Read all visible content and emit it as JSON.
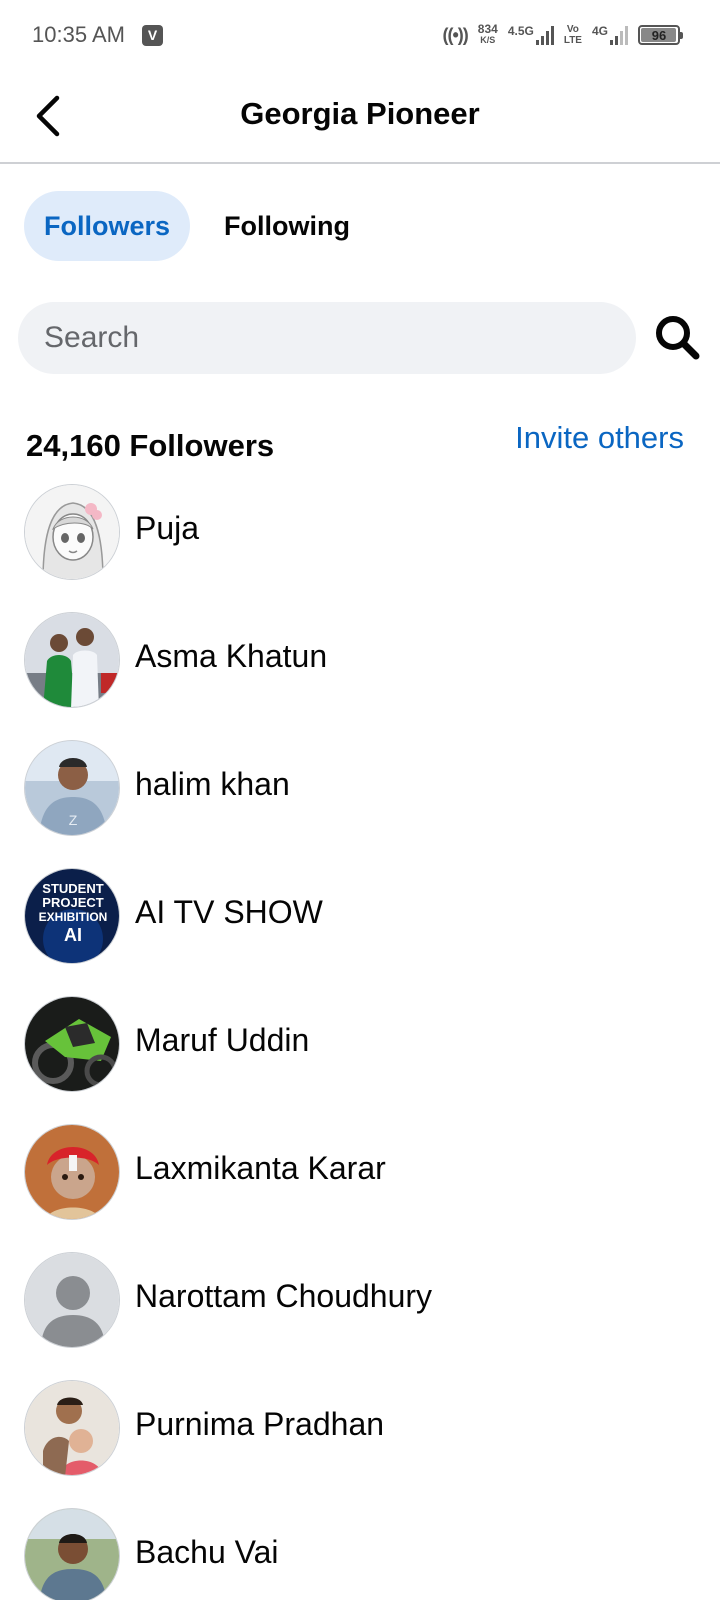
{
  "status_bar": {
    "time": "10:35 AM",
    "app_icon_letter": "V",
    "hotspot": "((•))",
    "speed_value": "834",
    "speed_unit": "K/S",
    "net1_label": "4.5G",
    "volte_top": "Vo",
    "volte_bottom": "LTE",
    "net2_label": "4G",
    "battery_percent": "96",
    "battery_level": 0.96
  },
  "header": {
    "title": "Georgia Pioneer"
  },
  "tabs": [
    {
      "label": "Followers",
      "active": true
    },
    {
      "label": "Following",
      "active": false
    }
  ],
  "search": {
    "placeholder": "Search",
    "value": ""
  },
  "summary": {
    "count_text": "24,160 Followers",
    "invite_label": "Invite others"
  },
  "followers": [
    {
      "name": "Puja",
      "avatar": "anime-girl"
    },
    {
      "name": "Asma Khatun",
      "avatar": "couple-photo"
    },
    {
      "name": "halim khan",
      "avatar": "man-photo"
    },
    {
      "name": "AI TV SHOW",
      "avatar": "ai-logo",
      "avatar_text": [
        "STUDENT",
        "PROJECT",
        "EXHIBITION",
        "AI"
      ]
    },
    {
      "name": "Maruf Uddin",
      "avatar": "motorcycle-photo"
    },
    {
      "name": "Laxmikanta Karar",
      "avatar": "child-photo"
    },
    {
      "name": "Narottam Choudhury",
      "avatar": "default-avatar"
    },
    {
      "name": "Purnima Pradhan",
      "avatar": "kids-photo"
    },
    {
      "name": "Bachu Vai",
      "avatar": "man-outdoor-photo"
    }
  ],
  "colors": {
    "accent": "#0a66c2",
    "active_tab_bg": "#dfebfa",
    "search_bg": "#f0f2f5",
    "divider": "#ced0d4"
  }
}
